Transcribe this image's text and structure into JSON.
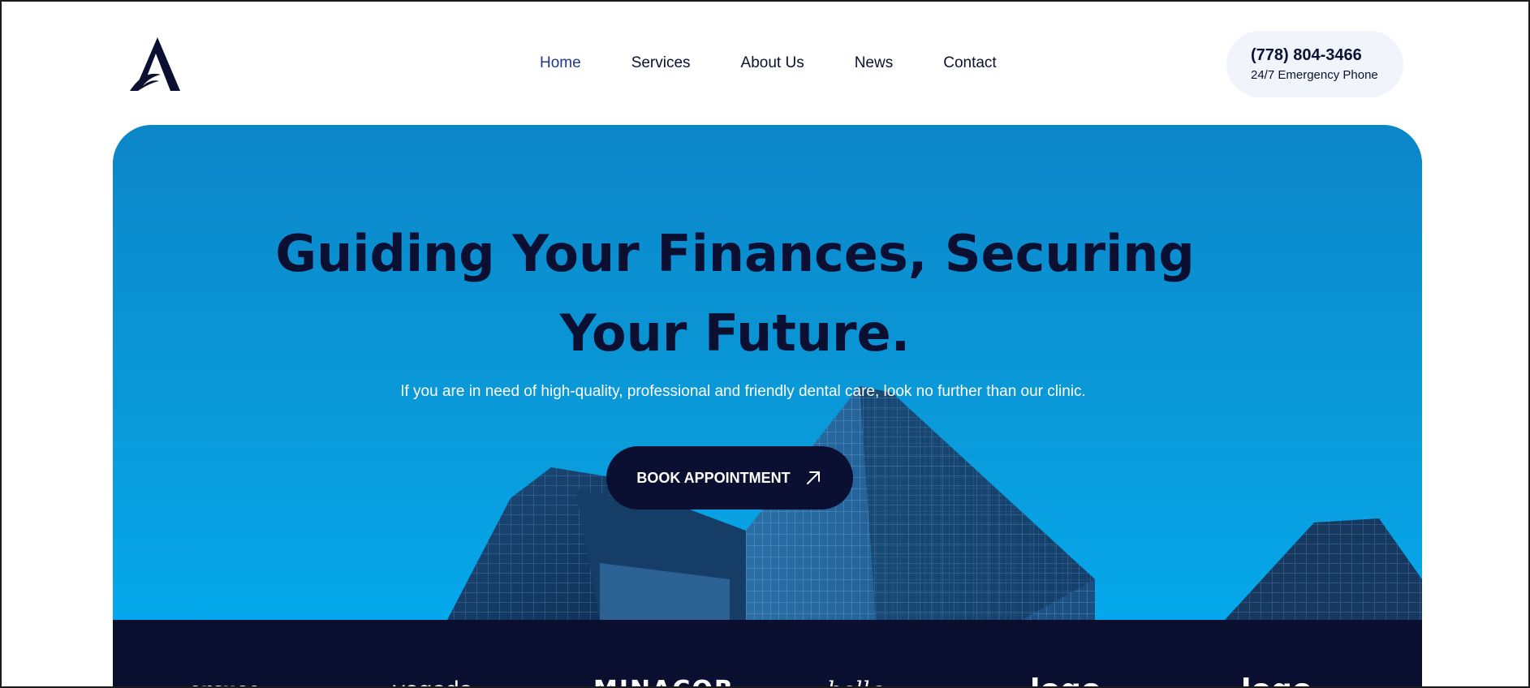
{
  "header": {
    "nav": [
      {
        "label": "Home",
        "active": true
      },
      {
        "label": "Services"
      },
      {
        "label": "About Us"
      },
      {
        "label": "News"
      },
      {
        "label": "Contact"
      }
    ],
    "phone": {
      "number": "(778) 804-3466",
      "caption": "24/7 Emergency Phone"
    },
    "logo_icon": "stylized-a-with-bird-logo"
  },
  "hero": {
    "title": "Guiding Your Finances, Securing Your Future.",
    "subtitle": "If you are in need of high-quality, professional and friendly dental care, look no further than our clinic.",
    "cta_label": "BOOK APPOINTMENT",
    "cta_icon": "arrow-up-right-icon",
    "background": "skyscrapers-against-blue-sky"
  },
  "brands": {
    "items": [
      "ercuse",
      "vegeda",
      "MINACOR",
      "bella",
      "logo",
      "logo"
    ]
  },
  "colors": {
    "navy": "#0b1033",
    "active_nav": "#1e3a8a",
    "phone_pill_bg": "#f1f5fb",
    "hero_blue": "#0a93d8",
    "band_bg": "#0a0f30"
  }
}
